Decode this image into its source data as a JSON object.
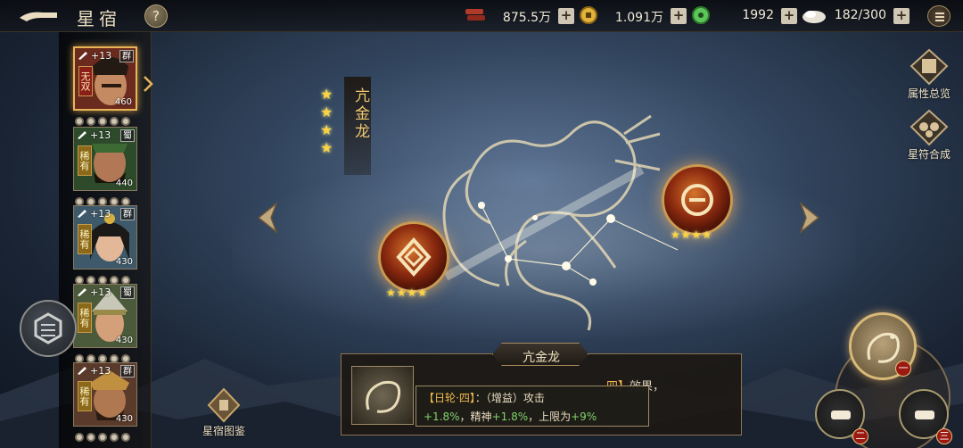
{
  "header": {
    "title": "星宿",
    "help_label": "?",
    "resources": [
      {
        "icon": "bronze-bars-icon",
        "value": "875.5万",
        "plus": "+"
      },
      {
        "icon": "copper-coin-icon",
        "value": "1.091万",
        "plus": "+"
      },
      {
        "icon": "jade-coin-icon",
        "value": "1992",
        "plus": "+"
      },
      {
        "icon": "rice-bag-icon",
        "value": "182/300",
        "plus": "+"
      }
    ]
  },
  "heroes": [
    {
      "plus": "+13",
      "faction": "群",
      "rank": "无双",
      "level": "460",
      "selected": true
    },
    {
      "plus": "+13",
      "faction": "蜀",
      "rank": "稀有",
      "level": "440",
      "selected": false
    },
    {
      "plus": "+13",
      "faction": "群",
      "rank": "稀有",
      "level": "430",
      "selected": false
    },
    {
      "plus": "+13",
      "faction": "蜀",
      "rank": "稀有",
      "level": "430",
      "selected": false
    },
    {
      "plus": "+13",
      "faction": "群",
      "rank": "稀有",
      "level": "430",
      "selected": false
    }
  ],
  "constellation": {
    "name": "亢金龙",
    "stars": 4,
    "orbs": [
      {
        "symbol": "diamond-rune-icon",
        "stars": "★★★★"
      },
      {
        "symbol": "sun-rune-icon",
        "stars": "★★★★"
      }
    ]
  },
  "side_tools": {
    "attribute_overview": "属性总览",
    "talisman_synthesis": "星符合成",
    "atlas": "星宿图鉴"
  },
  "bottom_buttons": {
    "badge_1": "一",
    "badge_2": "二",
    "badge_3": "三"
  },
  "info_panel": {
    "tab_title": "亢金龙",
    "effect_suffix": "效果，",
    "effect_highlight": "四】",
    "tooltip_line1_a": "【日轮·四】",
    "tooltip_line1_b": "：（增益）攻击",
    "tooltip_line2_prefix_1": "+1.8%",
    "tooltip_line2_mid_1": "，精神",
    "tooltip_line2_prefix_2": "+1.8%",
    "tooltip_line2_mid_2": "，上限为",
    "tooltip_line2_prefix_3": "+9%"
  }
}
